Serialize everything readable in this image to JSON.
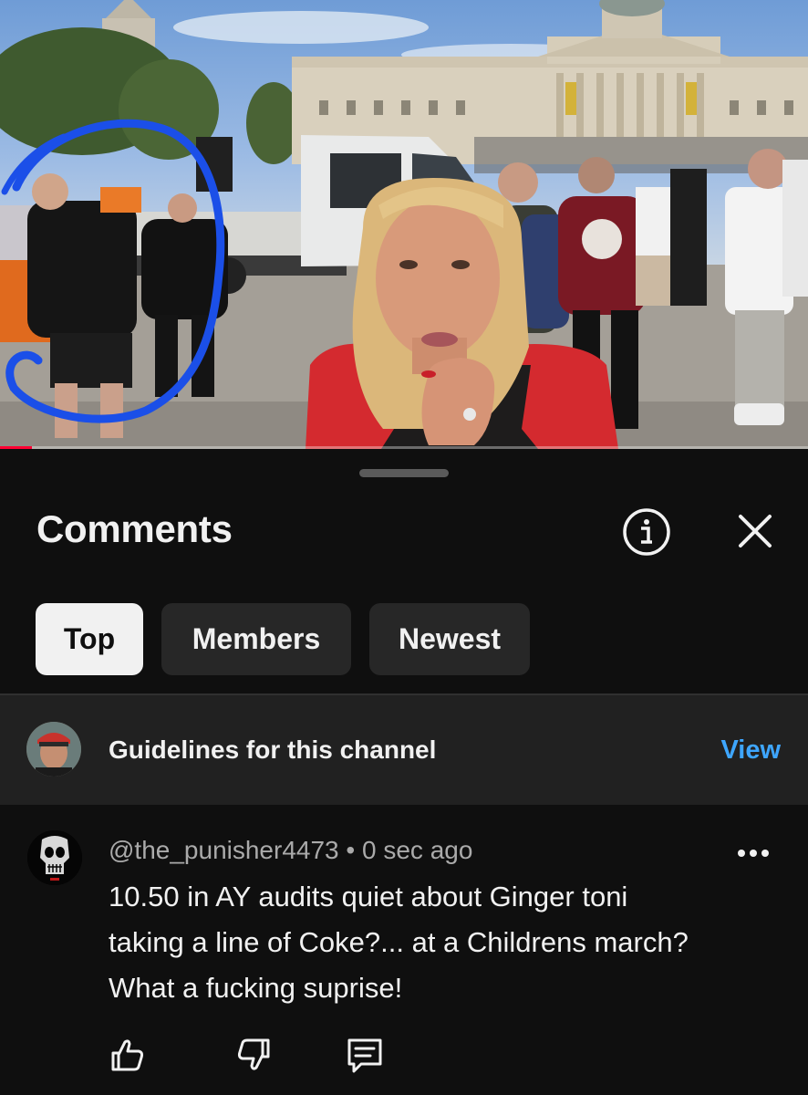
{
  "video": {
    "progress_fraction": 0.04,
    "accent_color": "#ff0033",
    "annotation_color": "#1b4fe8"
  },
  "sheet": {
    "title": "Comments",
    "info_icon": "info-icon",
    "close_icon": "close-icon"
  },
  "tabs": [
    {
      "label": "Top",
      "active": true
    },
    {
      "label": "Members",
      "active": false
    },
    {
      "label": "Newest",
      "active": false
    }
  ],
  "guidelines": {
    "text": "Guidelines for this channel",
    "action": "View",
    "action_color": "#3ea6ff"
  },
  "comment": {
    "author": "@the_punisher4473",
    "separator": "•",
    "time": "0 sec ago",
    "lines": [
      "10.50  in AY audits quiet about Ginger toni",
      "taking a line of Coke?... at a Childrens march?",
      "What a fucking suprise!"
    ],
    "actions": [
      "like-icon",
      "dislike-icon",
      "reply-icon"
    ]
  }
}
